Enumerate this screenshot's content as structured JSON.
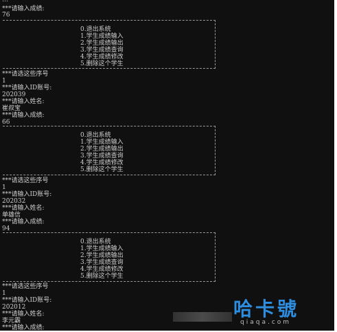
{
  "console": {
    "top": {
      "prompt": "***请输入成绩:",
      "value": "76"
    },
    "menu_items": [
      "0.退出系统",
      "1.学生成绩输入",
      "2.学生成绩输出",
      "3.学生成绩查询",
      "4.学生成绩修改",
      "5.删除这个学生"
    ],
    "select_prompt": "***请选这些序号",
    "id_prompt": "***请输入ID账号:",
    "name_prompt": "***请输入姓名:",
    "score_prompt": "***请输入成绩:",
    "blocks": [
      {
        "choice": "1",
        "id": "202039",
        "name": "崔叔宝",
        "score": "66"
      },
      {
        "choice": "1",
        "id": "202032",
        "name": "单雄信",
        "score": "94"
      },
      {
        "choice": "1",
        "id": "202012",
        "name": "李元霸"
      }
    ]
  },
  "watermark": {
    "logo": "哈卡號",
    "domain": "qiaqa.com"
  },
  "colors": {
    "background": "#101010",
    "text": "#cfcfcf",
    "watermark": "#2d8ee0"
  }
}
